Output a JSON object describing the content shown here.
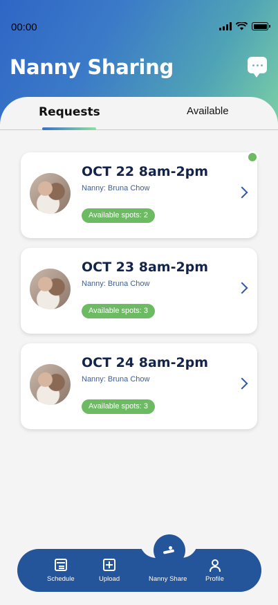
{
  "status": {
    "time": "00:00"
  },
  "header": {
    "title": "Nanny Sharing"
  },
  "tabs": [
    {
      "label": "Requests",
      "active": true
    },
    {
      "label": "Available",
      "active": false
    }
  ],
  "requests": [
    {
      "date": "OCT 22 8am-2pm",
      "nanny": "Nanny: Bruna Chow",
      "spots": "Available spots: 2",
      "unread": true
    },
    {
      "date": "OCT 23 8am-2pm",
      "nanny": "Nanny: Bruna Chow",
      "spots": "Available spots: 3",
      "unread": false
    },
    {
      "date": "OCT 24 8am-2pm",
      "nanny": "Nanny: Bruna Chow",
      "spots": "Available spots: 3",
      "unread": false
    }
  ],
  "nav": [
    {
      "label": "Schedule",
      "icon": "calendar-icon"
    },
    {
      "label": "Upload",
      "icon": "upload-icon"
    },
    {
      "label": "Nanny Share",
      "icon": "nanny-share-icon"
    },
    {
      "label": "Profile",
      "icon": "profile-icon"
    }
  ],
  "colors": {
    "primary": "#24549a",
    "accent_green": "#6cbb62",
    "gradient_start": "#2f66c6",
    "gradient_end": "#7fd3a4",
    "date_text": "#13244a"
  }
}
